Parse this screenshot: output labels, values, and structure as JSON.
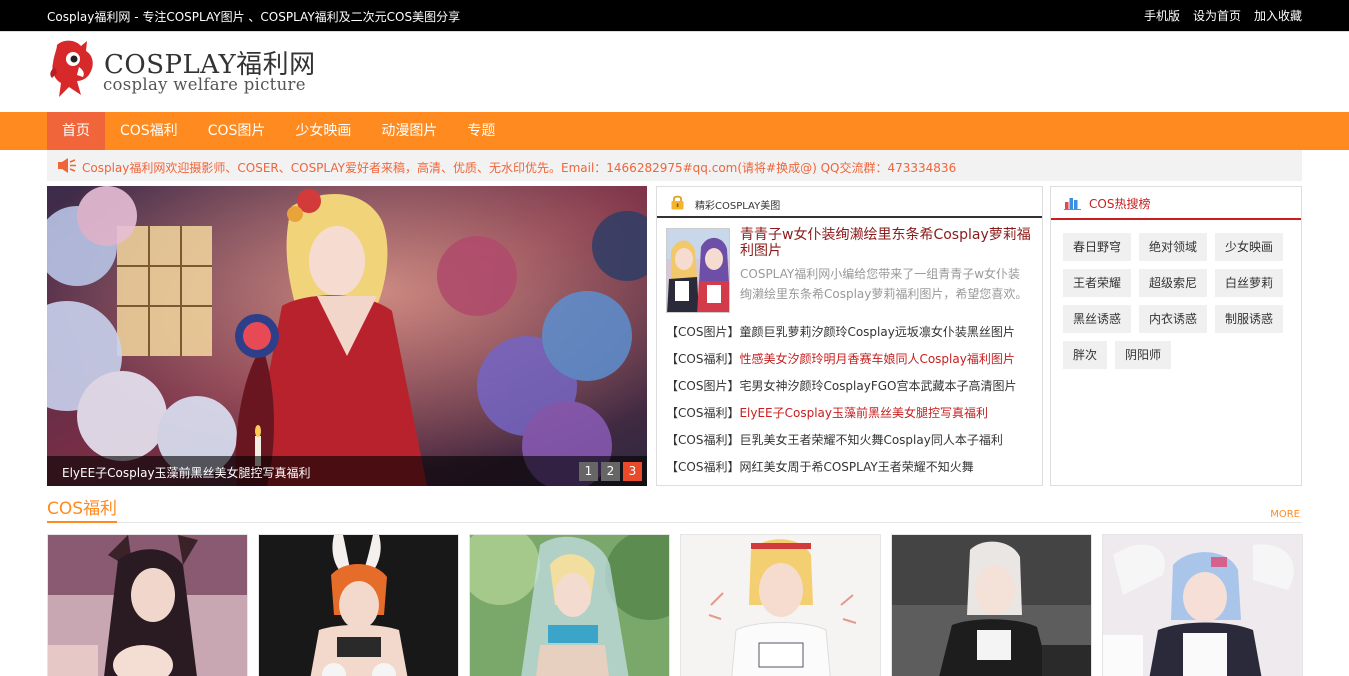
{
  "topbar": {
    "slogan": "Cosplay福利网 - 专注COSPLAY图片 、COSPLAY福利及二次元COS美图分享",
    "links": [
      "手机版",
      "设为首页",
      "加入收藏"
    ]
  },
  "logo": {
    "title": "COSPLAY福利网",
    "subtitle": "cosplay welfare picture"
  },
  "nav": {
    "items": [
      "首页",
      "COS福利",
      "COS图片",
      "少女映画",
      "动漫图片",
      "专题"
    ]
  },
  "notice": {
    "text": "Cosplay福利网欢迎摄影师、COSER、COSPLAY爱好者来稿，高清、优质、无水印优先。Email：1466282975#qq.com(请将#换成@) QQ交流群：473334836"
  },
  "slider": {
    "caption": "ElyEE子Cosplay玉藻前黑丝美女腿控写真福利",
    "dots": [
      "1",
      "2",
      "3"
    ],
    "active_dot": 3
  },
  "featured_panel": {
    "heading": "精彩COSPLAY美图",
    "featured_title": "青青子w女仆装绚濑绘里东条希Cosplay萝莉福利图片",
    "featured_desc": "COSPLAY福利网小编给您带来了一组青青子w女仆装绚濑绘里东条希Cosplay萝莉福利图片，希望您喜欢。",
    "list": [
      {
        "category": "【COS图片】",
        "title": "童颜巨乳萝莉汐颜玲Cosplay远坂凛女仆装黑丝图片",
        "highlight": false
      },
      {
        "category": "【COS福利】",
        "title": "性感美女汐颜玲明月香赛车娘同人Cosplay福利图片",
        "highlight": true
      },
      {
        "category": "【COS图片】",
        "title": "宅男女神汐颜玲CosplayFGO宫本武藏本子高清图片",
        "highlight": false
      },
      {
        "category": "【COS福利】",
        "title": "ElyEE子Cosplay玉藻前黑丝美女腿控写真福利",
        "highlight": true
      },
      {
        "category": "【COS福利】",
        "title": "巨乳美女王者荣耀不知火舞Cosplay同人本子福利",
        "highlight": false
      },
      {
        "category": "【COS福利】",
        "title": "网红美女周于希COSPLAY王者荣耀不知火舞",
        "highlight": false
      }
    ]
  },
  "hot_panel": {
    "heading": "COS热搜榜",
    "tags": [
      "春日野穹",
      "绝对领域",
      "少女映画",
      "王者荣耀",
      "超级索尼",
      "白丝萝莉",
      "黑丝诱惑",
      "内衣诱惑",
      "制服诱惑",
      "胖次",
      "阴阳师"
    ]
  },
  "section": {
    "title": "COS福利",
    "more": "MORE",
    "cards": [
      "card-1",
      "card-2",
      "card-3",
      "card-4",
      "card-5",
      "card-6"
    ]
  },
  "colors": {
    "accent": "#ff8a1f",
    "nav_active": "#f0653a",
    "highlight_red": "#c81e1e",
    "topbar": "#000000"
  }
}
